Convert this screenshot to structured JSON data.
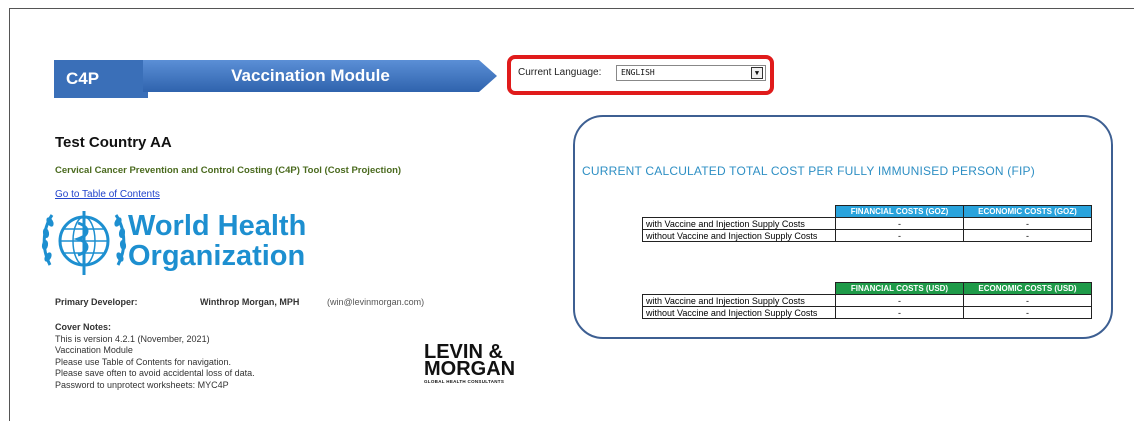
{
  "banner": {
    "badge": "C4P",
    "module": "Vaccination Module"
  },
  "language": {
    "label": "Current Language:",
    "value": "ENGLISH",
    "dropdown_icon": "chevron-down-icon"
  },
  "header": {
    "country": "Test  Country AA",
    "subtitle": "Cervical Cancer Prevention and Control Costing (C4P) Tool (Cost Projection)",
    "toc_link": "Go to Table of Contents"
  },
  "who": {
    "line1": "World Health",
    "line2": "Organization",
    "color": "#1d8fd0"
  },
  "developer": {
    "label": "Primary Developer:",
    "name": "Winthrop Morgan, MPH",
    "email": "(win@levinmorgan.com)"
  },
  "notes": {
    "heading": "Cover Notes:",
    "lines": [
      "This is version 4.2.1  (November, 2021)",
      "Vaccination Module",
      "Please use Table of Contents for navigation.",
      "Please save often to avoid accidental loss of data.",
      "Password to unprotect worksheets: MYC4P"
    ]
  },
  "levin_morgan": {
    "line1": "LEVIN &",
    "line2": "MORGAN",
    "line3": "GLOBAL HEALTH CONSULTANTS"
  },
  "panel": {
    "title": "CURRENT CALCULATED TOTAL COST PER FULLY IMMUNISED PERSON (FIP)",
    "table_goz": {
      "header_color": "#29a3dc",
      "columns": [
        "FINANCIAL COSTS (GOZ)",
        "ECONOMIC COSTS (GOZ)"
      ],
      "rows": [
        {
          "label": "with Vaccine and Injection Supply Costs",
          "values": [
            "-",
            "-"
          ]
        },
        {
          "label": "without Vaccine and Injection Supply Costs",
          "values": [
            "-",
            "-"
          ]
        }
      ]
    },
    "table_usd": {
      "header_color": "#1e9a48",
      "columns": [
        "FINANCIAL COSTS (USD)",
        "ECONOMIC COSTS (USD)"
      ],
      "rows": [
        {
          "label": "with Vaccine and Injection Supply Costs",
          "values": [
            "-",
            "-"
          ]
        },
        {
          "label": "without Vaccine and Injection Supply Costs",
          "values": [
            "-",
            "-"
          ]
        }
      ]
    }
  }
}
